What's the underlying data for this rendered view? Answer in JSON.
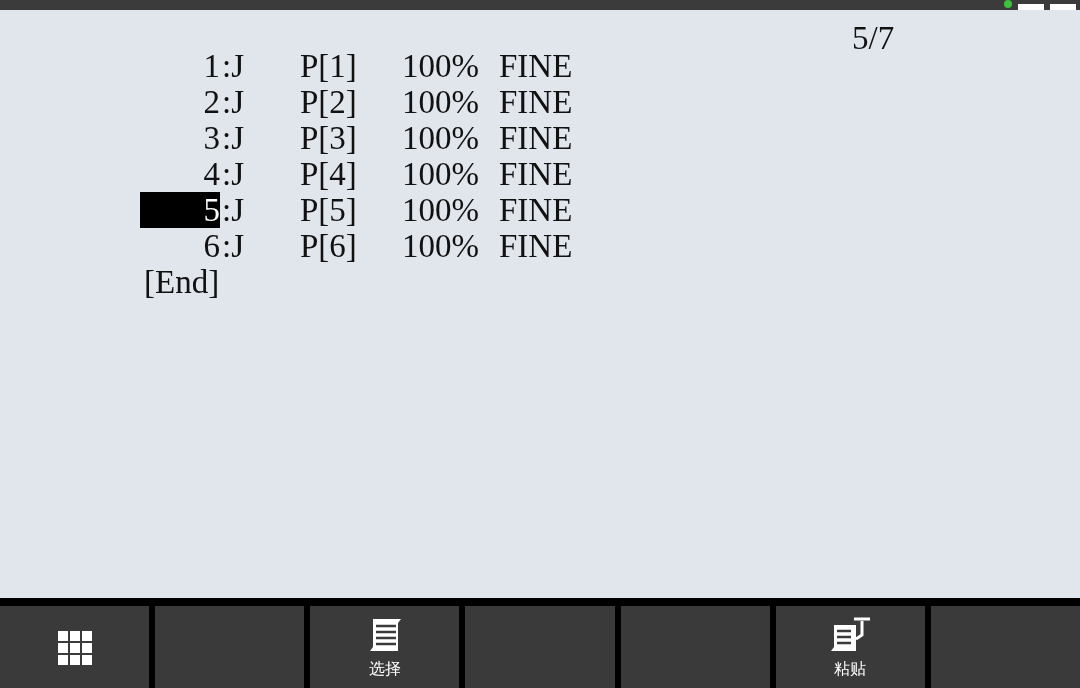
{
  "page_counter": "5/7",
  "lines": [
    {
      "number": "1",
      "motion": ":J",
      "position": "P[1]",
      "speed": "100%",
      "termination": "FINE",
      "selected": false
    },
    {
      "number": "2",
      "motion": ":J",
      "position": "P[2]",
      "speed": "100%",
      "termination": "FINE",
      "selected": false
    },
    {
      "number": "3",
      "motion": ":J",
      "position": "P[3]",
      "speed": "100%",
      "termination": "FINE",
      "selected": false
    },
    {
      "number": "4",
      "motion": ":J",
      "position": "P[4]",
      "speed": "100%",
      "termination": "FINE",
      "selected": false
    },
    {
      "number": "5",
      "motion": ":J",
      "position": "P[5]",
      "speed": "100%",
      "termination": "FINE",
      "selected": true
    },
    {
      "number": "6",
      "motion": ":J",
      "position": "P[6]",
      "speed": "100%",
      "termination": "FINE",
      "selected": false
    }
  ],
  "end_marker": "[End]",
  "function_keys": [
    {
      "kind": "menu"
    },
    {
      "kind": "empty"
    },
    {
      "kind": "select",
      "label": "选择"
    },
    {
      "kind": "empty"
    },
    {
      "kind": "empty"
    },
    {
      "kind": "paste",
      "label": "粘贴"
    },
    {
      "kind": "empty"
    }
  ]
}
